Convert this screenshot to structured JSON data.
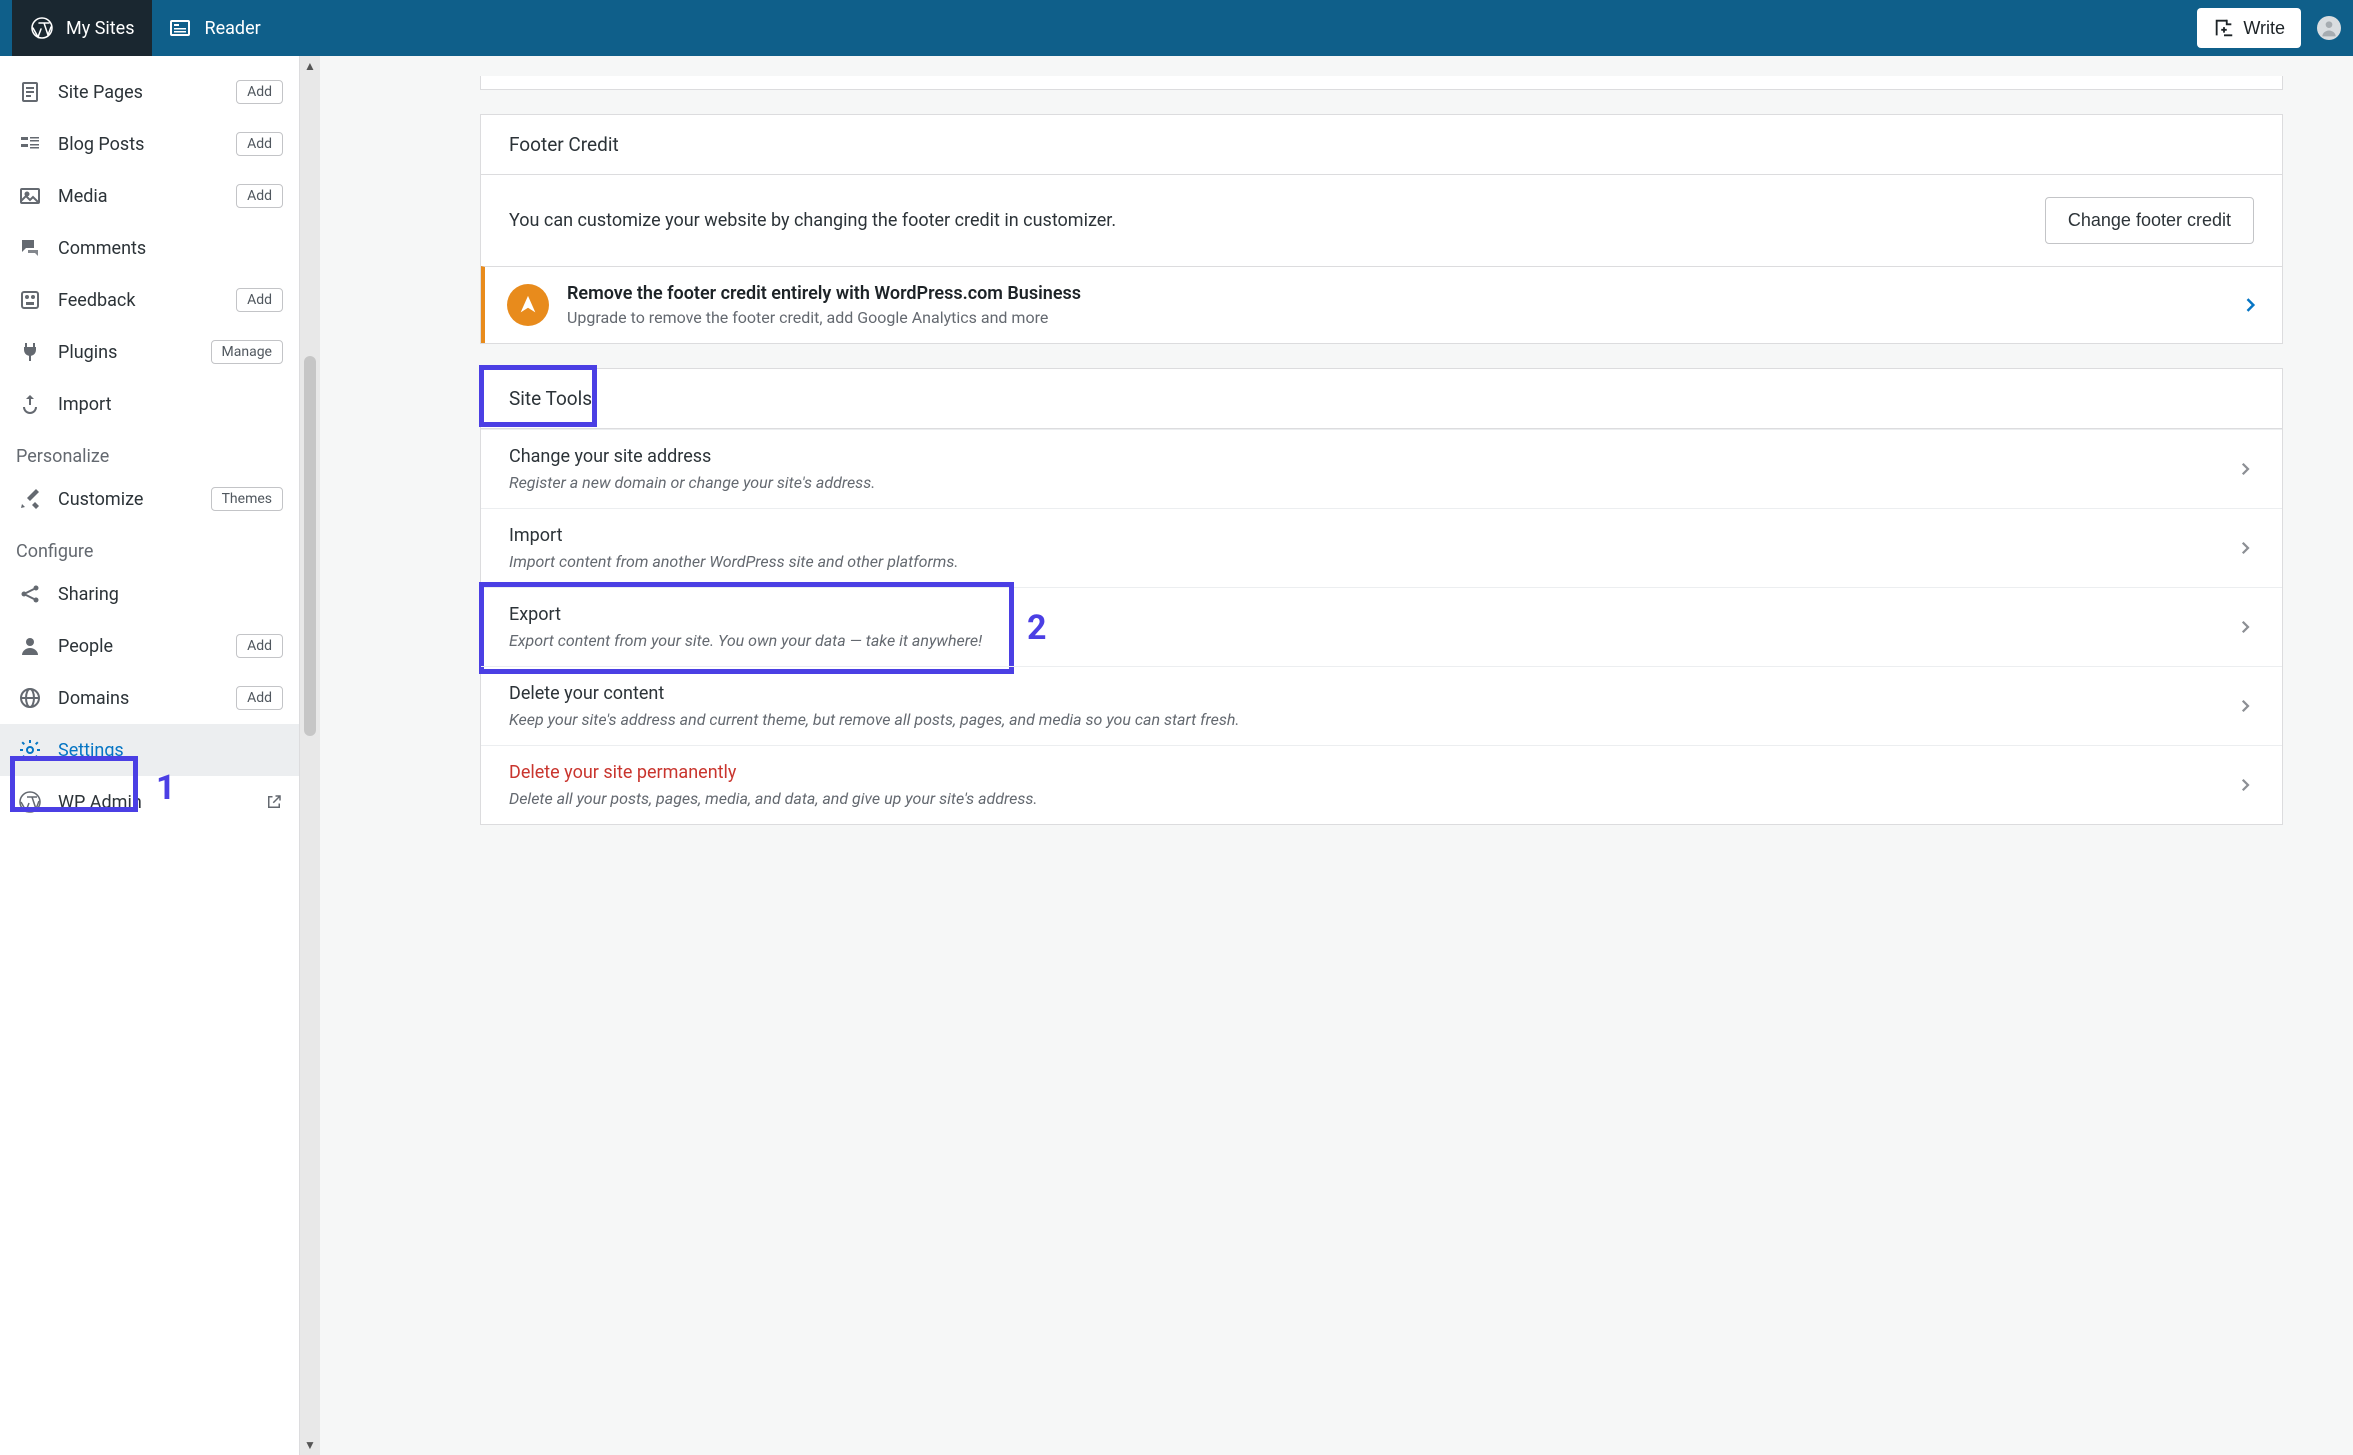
{
  "topbar": {
    "mysites": "My Sites",
    "reader": "Reader",
    "write": "Write"
  },
  "sidebar": {
    "items": [
      {
        "label": "Site Pages",
        "pill": "Add"
      },
      {
        "label": "Blog Posts",
        "pill": "Add"
      },
      {
        "label": "Media",
        "pill": "Add"
      },
      {
        "label": "Comments"
      },
      {
        "label": "Feedback",
        "pill": "Add"
      },
      {
        "label": "Plugins",
        "pill": "Manage"
      },
      {
        "label": "Import"
      }
    ],
    "section_personalize": "Personalize",
    "customize": {
      "label": "Customize",
      "pill": "Themes"
    },
    "section_configure": "Configure",
    "configure": [
      {
        "label": "Sharing"
      },
      {
        "label": "People",
        "pill": "Add"
      },
      {
        "label": "Domains",
        "pill": "Add"
      },
      {
        "label": "Settings"
      },
      {
        "label": "WP Admin"
      }
    ]
  },
  "annotations": {
    "one": "1",
    "two": "2"
  },
  "footer_card": {
    "header": "Footer Credit",
    "body": "You can customize your website by changing the footer credit in customizer.",
    "button": "Change footer credit",
    "promo_title": "Remove the footer credit entirely with WordPress.com Business",
    "promo_sub": "Upgrade to remove the footer credit, add Google Analytics and more"
  },
  "tools_card": {
    "header": "Site Tools",
    "rows": [
      {
        "title": "Change your site address",
        "sub": "Register a new domain or change your site's address."
      },
      {
        "title": "Import",
        "sub": "Import content from another WordPress site and other platforms."
      },
      {
        "title": "Export",
        "sub": "Export content from your site. You own your data — take it anywhere!"
      },
      {
        "title": "Delete your content",
        "sub": "Keep your site's address and current theme, but remove all posts, pages, and media so you can start fresh."
      },
      {
        "title": "Delete your site permanently",
        "sub": "Delete all your posts, pages, media, and data, and give up your site's address."
      }
    ]
  }
}
